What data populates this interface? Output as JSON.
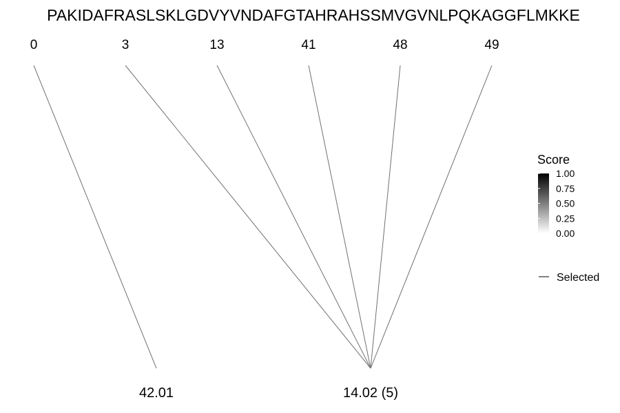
{
  "sequence": "PAKIDAFRASLSKLGDVYVNDAFGTAHRAHSSMVGVNLPQKAGGFLMKKE",
  "top_nodes": [
    {
      "label": "0"
    },
    {
      "label": "3"
    },
    {
      "label": "13"
    },
    {
      "label": "41"
    },
    {
      "label": "48"
    },
    {
      "label": "49"
    }
  ],
  "bottom_nodes": [
    {
      "label": "42.01"
    },
    {
      "label": "14.02 (5)"
    }
  ],
  "edges": [
    {
      "from": 0,
      "to": 0
    },
    {
      "from": 1,
      "to": 1
    },
    {
      "from": 2,
      "to": 1
    },
    {
      "from": 3,
      "to": 1
    },
    {
      "from": 4,
      "to": 1
    },
    {
      "from": 5,
      "to": 1
    }
  ],
  "legend": {
    "title": "Score",
    "ticks": [
      "1.00",
      "0.75",
      "0.50",
      "0.25",
      "0.00"
    ],
    "selected_label": "Selected"
  },
  "colors": {
    "edge": "#707070",
    "gradient_high": "#000000",
    "gradient_low": "#ffffff"
  }
}
